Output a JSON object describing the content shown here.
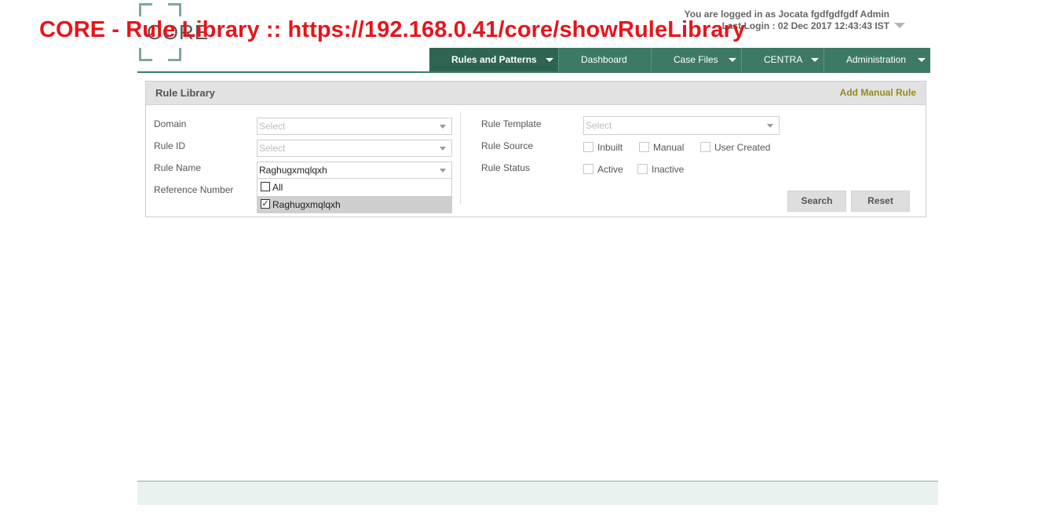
{
  "overlay_title": "CORE - Rule Library :: https://192.168.0.41/core/showRuleLibrary",
  "logo": {
    "text": "CORE"
  },
  "user": {
    "logged_in": "You are logged in as Jocata fgdfgdfgdf Admin",
    "last_login": "Last Login : 02 Dec 2017 12:43:43 IST"
  },
  "nav": {
    "items": [
      {
        "label": "Rules and Patterns",
        "active": true
      },
      {
        "label": "Dashboard"
      },
      {
        "label": "Case Files"
      },
      {
        "label": "CENTRA"
      },
      {
        "label": "Administration"
      }
    ]
  },
  "panel": {
    "title": "Rule Library",
    "add_label": "Add Manual Rule"
  },
  "form": {
    "domain": {
      "label": "Domain",
      "placeholder": "Select"
    },
    "rule_id": {
      "label": "Rule ID",
      "placeholder": "Select"
    },
    "rule_name": {
      "label": "Rule Name",
      "value": "Raghugxmqlqxh",
      "options": [
        {
          "label": "All",
          "checked": false
        },
        {
          "label": "Raghugxmqlqxh",
          "checked": true
        }
      ]
    },
    "reference_number": {
      "label": "Reference Number"
    },
    "rule_template": {
      "label": "Rule Template",
      "placeholder": "Select"
    },
    "rule_source": {
      "label": "Rule Source",
      "options": [
        "Inbuilt",
        "Manual",
        "User Created"
      ]
    },
    "rule_status": {
      "label": "Rule Status",
      "options": [
        "Active",
        "Inactive"
      ]
    },
    "search_label": "Search",
    "reset_label": "Reset"
  }
}
